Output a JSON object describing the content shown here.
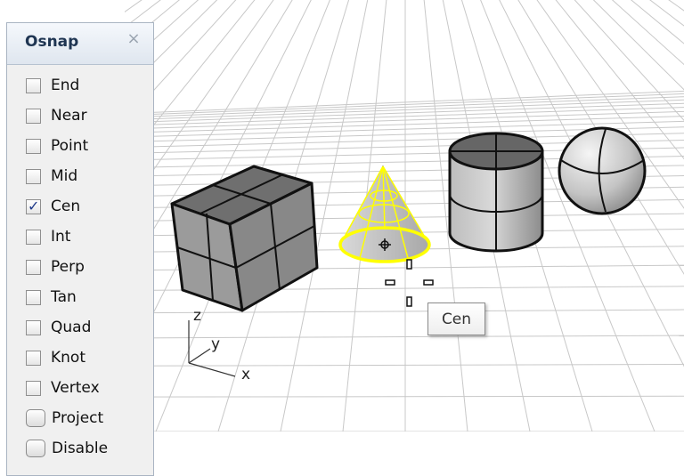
{
  "panel": {
    "title": "Osnap",
    "close_icon": "close-icon",
    "items": [
      {
        "label": "End",
        "checked": false,
        "kind": "checkbox"
      },
      {
        "label": "Near",
        "checked": false,
        "kind": "checkbox"
      },
      {
        "label": "Point",
        "checked": false,
        "kind": "checkbox"
      },
      {
        "label": "Mid",
        "checked": false,
        "kind": "checkbox"
      },
      {
        "label": "Cen",
        "checked": true,
        "kind": "checkbox"
      },
      {
        "label": "Int",
        "checked": false,
        "kind": "checkbox"
      },
      {
        "label": "Perp",
        "checked": false,
        "kind": "checkbox"
      },
      {
        "label": "Tan",
        "checked": false,
        "kind": "checkbox"
      },
      {
        "label": "Quad",
        "checked": false,
        "kind": "checkbox"
      },
      {
        "label": "Knot",
        "checked": false,
        "kind": "checkbox"
      },
      {
        "label": "Vertex",
        "checked": false,
        "kind": "checkbox"
      }
    ],
    "buttons": [
      {
        "label": "Project"
      },
      {
        "label": "Disable"
      }
    ]
  },
  "viewport": {
    "axis": {
      "z": "z",
      "y": "y",
      "x": "x"
    },
    "tooltip": "Cen",
    "colors": {
      "selection": "#ffff00",
      "grid": "#c8c8c8",
      "object_dark": "#6a6a6a"
    }
  }
}
